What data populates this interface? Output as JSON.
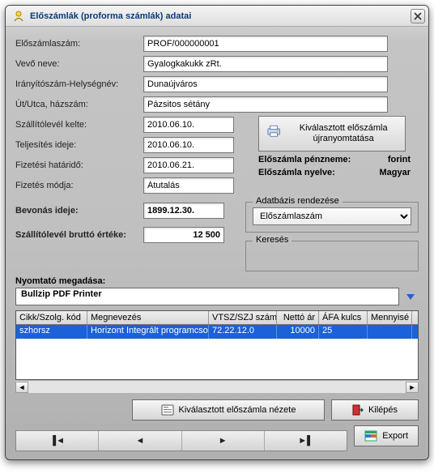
{
  "window": {
    "title": "Előszámlák (proforma számlák) adatai"
  },
  "labels": {
    "eloszamlaszam": "Előszámlaszám:",
    "vevo_neve": "Vevő neve:",
    "iranyitoszam": "Irányítószám-Helységnév:",
    "ut_utca": "Út/Utca, házszám:",
    "szallitolevel_kelte": "Szállítólevél kelte:",
    "teljesites_ideje": "Teljesítés ideje:",
    "fizetesi_hatarido": "Fizetési határidő:",
    "fizetes_modja": "Fizetés módja:",
    "bevonas_ideje": "Bevonás ideje:",
    "brutto": "Szállítólevél bruttó értéke:",
    "nyomtato": "Nyomtató megadása:"
  },
  "values": {
    "eloszamlaszam": "PROF/000000001",
    "vevo_neve": "Gyalogkakukk zRt.",
    "iranyitoszam": "Dunaújváros",
    "ut_utca": "Pázsitos sétány",
    "szallitolevel_kelte": "2010.06.10.",
    "teljesites_ideje": "2010.06.10.",
    "fizetesi_hatarido": "2010.06.21.",
    "fizetes_modja": "Átutalás",
    "bevonas_ideje": "1899.12.30.",
    "brutto": "12 500",
    "nyomtato": "Bullzip PDF Printer"
  },
  "right": {
    "reprint": "Kiválasztott előszámla újranyomtatása",
    "penznem_label": "Előszámla pénzneme:",
    "penznem_value": "forint",
    "nyelv_label": "Előszámla nyelve:",
    "nyelv_value": "Magyar"
  },
  "groups": {
    "sort_title": "Adatbázis rendezése",
    "sort_value": "Előszámlaszám",
    "search_title": "Keresés"
  },
  "grid": {
    "headers": [
      "Cikk/Szolg. kód",
      "Megnevezés",
      "VTSZ/SZJ szám",
      "Nettó ár",
      "ÁFA kulcs",
      "Mennyisé"
    ],
    "rows": [
      {
        "kod": "szhorsz",
        "megn": "Horizont Integrált programcso",
        "vtsz": "72.22.12.0",
        "netto": "10000",
        "afa": "25",
        "menny": ""
      }
    ]
  },
  "buttons": {
    "view": "Kiválasztott előszámla nézete",
    "exit": "Kilépés",
    "export": "Export"
  }
}
